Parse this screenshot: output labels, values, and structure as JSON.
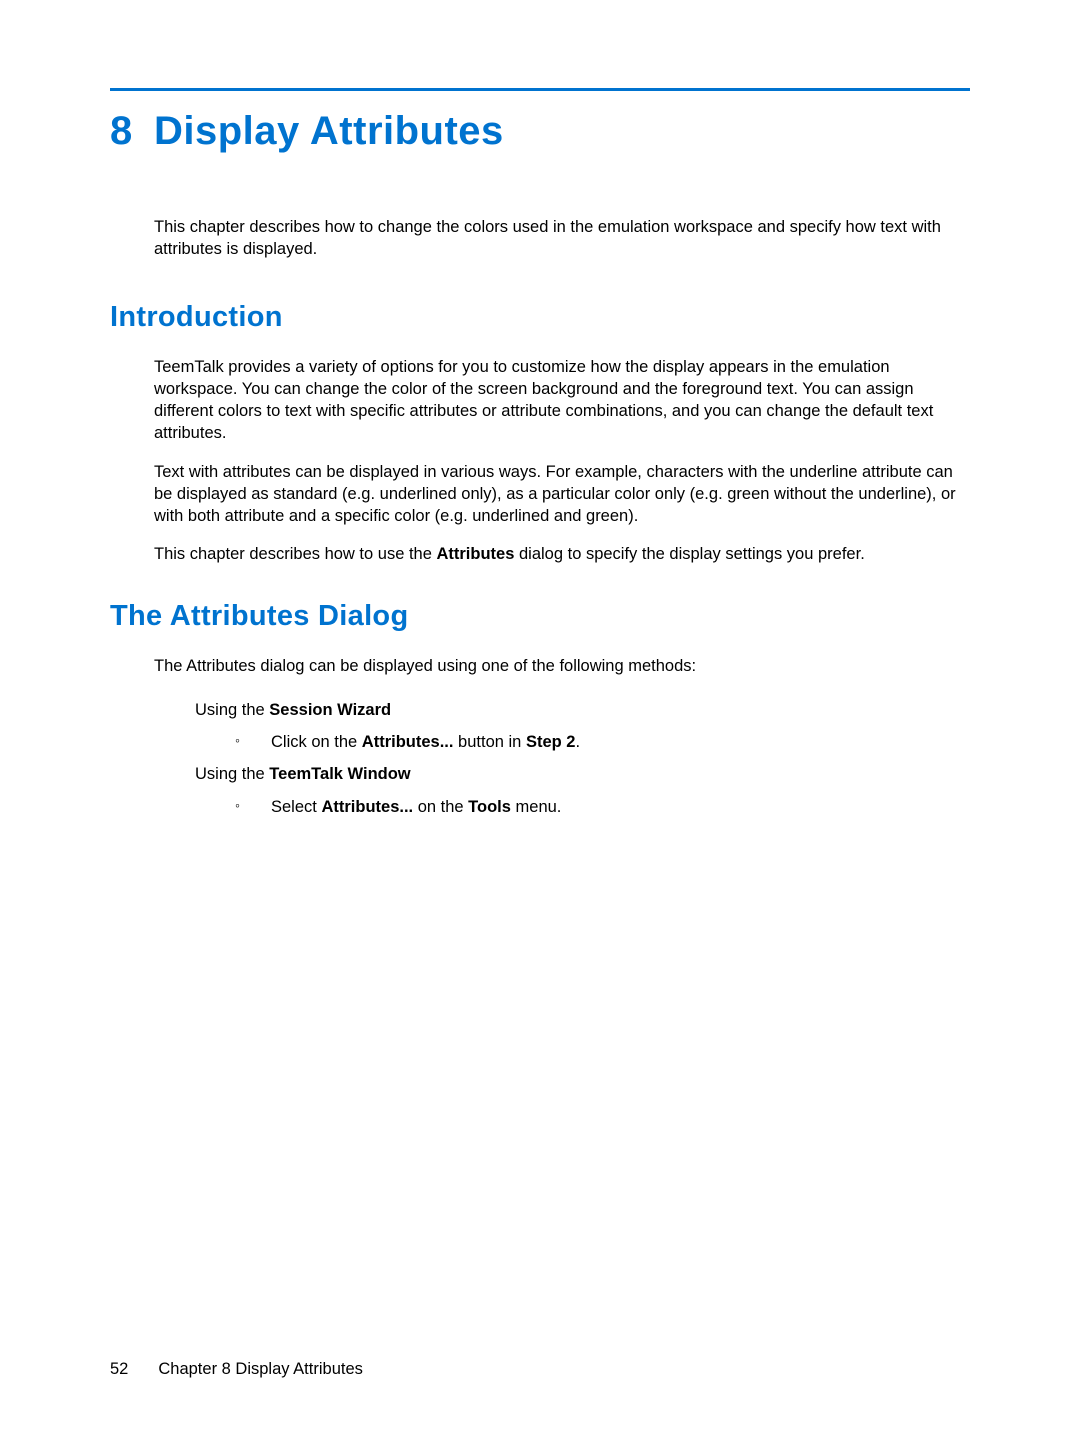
{
  "chapter": {
    "number": "8",
    "title": "Display Attributes",
    "intro": "This chapter describes how to change the colors used in the emulation workspace and specify how text with attributes is displayed."
  },
  "sections": {
    "introduction": {
      "heading": "Introduction",
      "para1": "TeemTalk provides a variety of options for you to customize how the display appears in the emulation workspace. You can change the color of the screen background and the foreground text. You can assign different colors to text with specific attributes or attribute combinations, and you can change the default text attributes.",
      "para2": "Text with attributes can be displayed in various ways. For example, characters with the underline attribute can be displayed as standard (e.g. underlined only), as a particular color only (e.g. green without the underline), or with both attribute and a specific color (e.g. underlined and green).",
      "para3_pre": "This chapter describes how to use the ",
      "para3_bold": "Attributes",
      "para3_post": " dialog to specify the display settings you prefer."
    },
    "attributes_dialog": {
      "heading": "The Attributes Dialog",
      "lead": "The Attributes dialog can be displayed using one of the following methods:",
      "method1": {
        "label_pre": "Using the ",
        "label_bold": "Session Wizard",
        "bullet_pre": "Click on the ",
        "bullet_bold1": "Attributes...",
        "bullet_mid": " button in ",
        "bullet_bold2": "Step 2",
        "bullet_post": "."
      },
      "method2": {
        "label_pre": "Using the ",
        "label_bold": "TeemTalk Window",
        "bullet_pre": "Select ",
        "bullet_bold1": "Attributes...",
        "bullet_mid": " on the ",
        "bullet_bold2": "Tools",
        "bullet_post": " menu."
      }
    }
  },
  "footer": {
    "page": "52",
    "chapter_label": "Chapter 8   Display Attributes"
  }
}
